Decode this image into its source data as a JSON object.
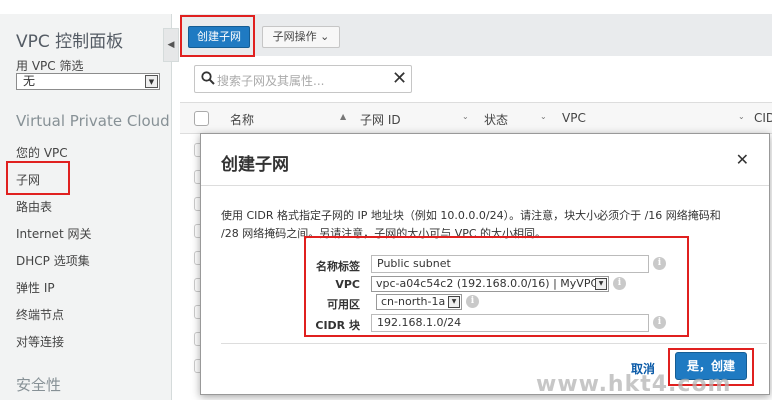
{
  "sidebar": {
    "title": "VPC 控制面板",
    "filter_label": "用 VPC 筛选",
    "filter_value": "无",
    "section_vpc": "Virtual Private Cloud",
    "items": [
      {
        "label": "您的 VPC"
      },
      {
        "label": "子网"
      },
      {
        "label": "路由表"
      },
      {
        "label": "Internet 网关"
      },
      {
        "label": "DHCP 选项集"
      },
      {
        "label": "弹性 IP"
      },
      {
        "label": "终端节点"
      },
      {
        "label": "对等连接"
      }
    ],
    "section_security": "安全性"
  },
  "toolbar": {
    "create_label": "创建子网",
    "actions_label": "子网操作 ⌄"
  },
  "search": {
    "placeholder": "搜索子网及其属性..."
  },
  "table": {
    "columns": [
      "名称",
      "子网 ID",
      "状态",
      "VPC",
      "CID"
    ]
  },
  "modal": {
    "title": "创建子网",
    "description": "使用 CIDR 格式指定子网的 IP 地址块（例如 10.0.0.0/24）。请注意，块大小必须介于 /16 网络掩码和 /28 网络掩码之间。另请注意，子网的大小可与 VPC 的大小相同。",
    "fields": {
      "name_label": "名称标签",
      "name_value": "Public subnet",
      "vpc_label": "VPC",
      "vpc_value": "vpc-a04c54c2 (192.168.0.0/16) | MyVPC",
      "az_label": "可用区",
      "az_value": "cn-north-1a",
      "cidr_label": "CIDR 块",
      "cidr_value": "192.168.1.0/24"
    },
    "cancel_label": "取消",
    "confirm_label": "是，创建"
  },
  "watermark": "www.hkt4.com",
  "colors": {
    "primary_button": "#1f7ac2",
    "annotation_red": "#e0201f",
    "link": "#0b5ba8"
  }
}
